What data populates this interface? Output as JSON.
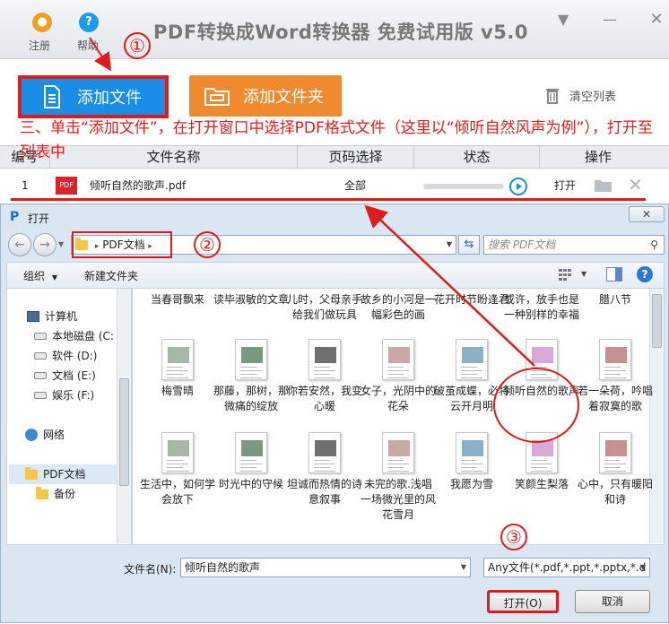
{
  "app": {
    "title": "PDF转换成Word转换器 免费试用版 v5.0",
    "register_label": "注册",
    "help_label": "帮助",
    "add_file_label": "添加文件",
    "add_folder_label": "添加文件夹",
    "clear_list_label": "清空列表"
  },
  "instruction": "三、单击“添加文件”，在打开窗口中选择PDF格式文件（这里以“倾听自然风声为例”），打开至列表中",
  "table": {
    "columns": [
      "编号",
      "文件名称",
      "页码选择",
      "状态",
      "操作"
    ],
    "rows": [
      {
        "number": "1",
        "file_name": "倾听自然的歌声.pdf",
        "page_selection": "全部",
        "open_label": "打开"
      }
    ]
  },
  "dialog": {
    "title": "打开",
    "breadcrumb": "PDF文档",
    "search_placeholder": "搜索 PDF文档",
    "organize_label": "组织",
    "new_folder_label": "新建文件夹",
    "nav": {
      "computer": "计算机",
      "drives": [
        "本地磁盘 (C:",
        "软件 (D:)",
        "文档 (E:)",
        "娱乐 (F:)"
      ],
      "network": "网络",
      "folder": "PDF文档",
      "subfolder": "备份"
    },
    "files_row1": [
      "当春哥飘来",
      "读毕淑敏的文章",
      "儿时，父母亲手给我们做玩具",
      "故乡的小河是一幅彩色的画",
      "花开时节盼逢君",
      "或许，放手也是一种别样的幸福",
      "腊八节"
    ],
    "files_row2": [
      "梅雪晴",
      "那藤，那树，那微痛的绽放",
      "你若安然，我变心暖",
      "女子，光阴中的花朵",
      "破茧成蝶，必将云开月明",
      "倾听自然的歌声",
      "若一朵荷，吟唱着寂寞的歌"
    ],
    "files_row3": [
      "生活中，如何学会放下",
      "时光中的守候",
      "坦诚而热情的诗意叙事",
      "未完的歌.浅唱一场微光里的风花雪月",
      "我愿为雪",
      "笑颜生梨落",
      "心中，只有暖阳和诗"
    ],
    "filename_label": "文件名(N):",
    "filename_value": "倾听自然的歌声",
    "filetype_value": "Any文件(*.pdf,*.ppt,*.pptx,*.d",
    "open_button": "打开(O)",
    "cancel_button": "取消"
  },
  "step_numbers": [
    "①",
    "②",
    "③"
  ],
  "colors": {
    "accent_blue": "#1a8ee6",
    "accent_orange": "#ef8a2e",
    "highlight_red": "#e11a1a"
  }
}
